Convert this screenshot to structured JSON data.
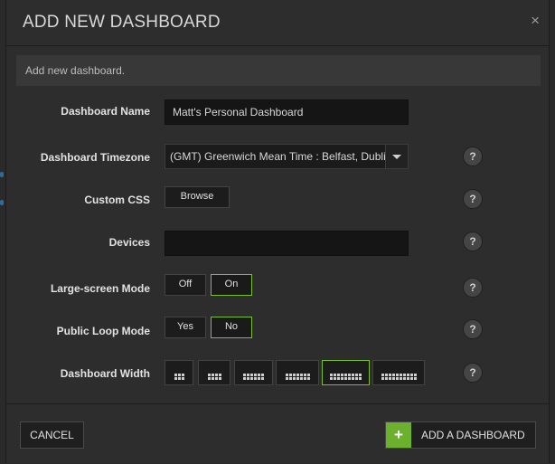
{
  "dialog": {
    "title": "ADD NEW DASHBOARD",
    "close_icon": "×",
    "info": "Add new dashboard."
  },
  "form": {
    "name": {
      "label": "Dashboard Name",
      "value": "Matt's Personal Dashboard"
    },
    "timezone": {
      "label": "Dashboard Timezone",
      "value": "(GMT) Greenwich Mean Time : Belfast, Dublin"
    },
    "css": {
      "label": "Custom CSS",
      "button": "Browse"
    },
    "devices": {
      "label": "Devices",
      "value": ""
    },
    "large_screen": {
      "label": "Large-screen Mode",
      "options": [
        "Off",
        "On"
      ],
      "selected": "On"
    },
    "public_loop": {
      "label": "Public Loop Mode",
      "options": [
        "Yes",
        "No"
      ],
      "selected": "No"
    },
    "width": {
      "label": "Dashboard Width",
      "options_dot_columns": [
        3,
        4,
        6,
        7,
        9,
        10
      ],
      "selected_index": 4
    }
  },
  "help_icon": "?",
  "footer": {
    "cancel": "CANCEL",
    "add_icon": "+",
    "add": "ADD A DASHBOARD"
  },
  "colors": {
    "accent": "#7bbf2a",
    "add_icon_bg": "#6bb12d"
  }
}
